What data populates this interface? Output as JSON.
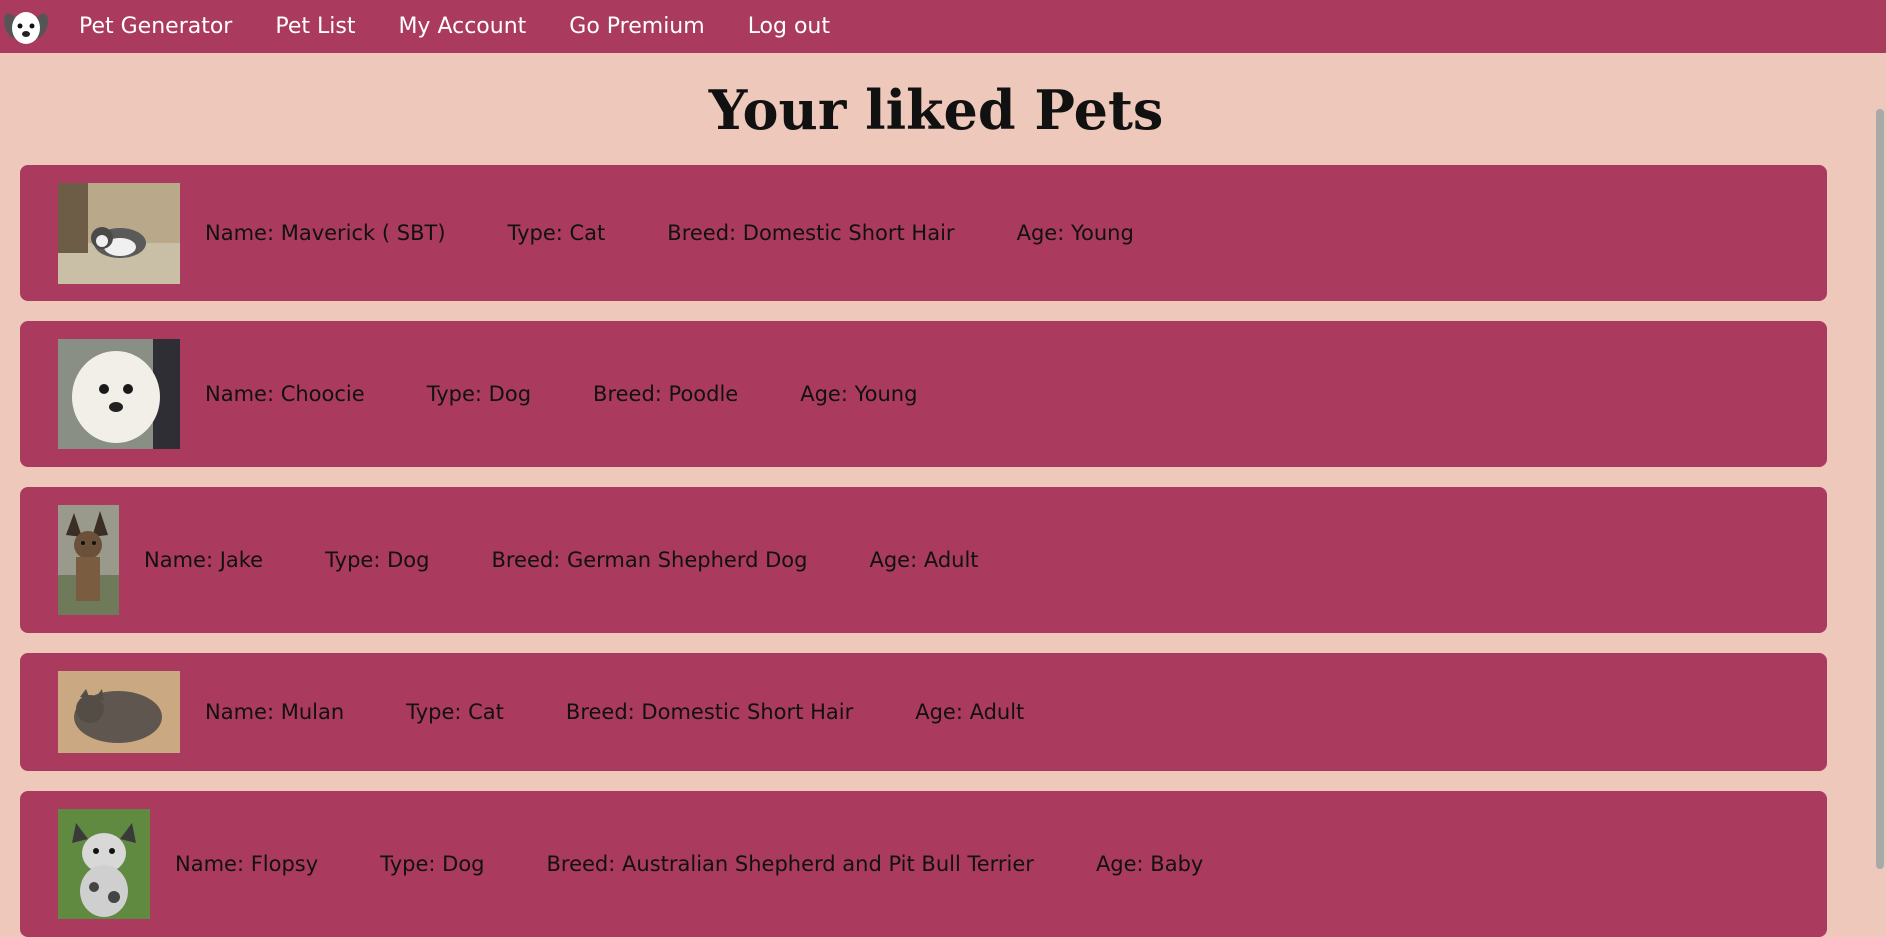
{
  "nav": {
    "logo_icon": "dog-face-icon",
    "links": [
      "Pet Generator",
      "Pet List",
      "My Account",
      "Go Premium",
      "Log out"
    ]
  },
  "page_title": "Your liked Pets",
  "pets": [
    {
      "name": "Name: Maverick ( SBT)",
      "type": "Type: Cat",
      "breed": "Breed: Domestic Short Hair",
      "age": "Age: Young",
      "photo": "cat-photo"
    },
    {
      "name": "Name: Choocie",
      "type": "Type: Dog",
      "breed": "Breed: Poodle",
      "age": "Age: Young",
      "photo": "dog-photo"
    },
    {
      "name": "Name: Jake",
      "type": "Type: Dog",
      "breed": "Breed: German Shepherd Dog",
      "age": "Age: Adult",
      "photo": "dog-photo"
    },
    {
      "name": "Name: Mulan",
      "type": "Type: Cat",
      "breed": "Breed: Domestic Short Hair",
      "age": "Age: Adult",
      "photo": "cat-photo"
    },
    {
      "name": "Name: Flopsy",
      "type": "Type: Dog",
      "breed": "Breed: Australian Shepherd and Pit Bull Terrier",
      "age": "Age: Baby",
      "photo": "dog-photo"
    }
  ],
  "colors": {
    "nav_bg": "#aa3a5e",
    "page_bg": "#eec8ba",
    "card_bg": "#aa3a5e"
  }
}
